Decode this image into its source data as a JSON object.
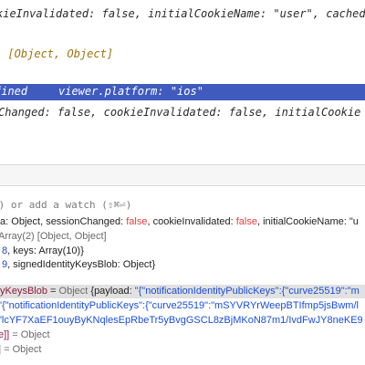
{
  "console": {
    "line1": "kieInvalidated: false, initialCookieName: \"user\", cached",
    "line2": ") [Object, Object]",
    "highlight_a": "fined",
    "highlight_b": "viewer.platform: \"ios\"",
    "line4": "Changed: false, cookieInvalidated: false, initialCookie"
  },
  "watch_hint": "⏎) or add a watch (⇧⌘⏎)",
  "variables": {
    "r1_a": "ta: Object, sessionChanged: ",
    "r1_false1": "false",
    "r1_b": ", cookieInvalidated: ",
    "r1_false2": "false",
    "r1_c": ", initialCookieName: \"u",
    "r2": "Array(2) [Object, Object]",
    "r3_num": "8",
    "r3_rest": ", keys: Array(10)}",
    "r4_num": "9",
    "r4_rest": ", signedIdentityKeysBlob: Object}",
    "r5_name": "yKeysBlob",
    "r5_eq": " = ",
    "r5_type": "Object ",
    "r5_val_a": "{payload: ",
    "r5_val_b": "\"{\"notificationIdentityPublicKeys\":{\"curve25519\":\"m",
    "r6": "'{\"notificationIdentityPublicKeys\":{\"curve25519\":\"mSYVRYrWeepBTIfmp5jsBwm/l",
    "r7": "\"lcYF7XaEF1ouyByKNqlesEpRbeTr5yBvgGSCL8zBjMKoN87m1/IvdFwJY8neKE9",
    "r8_name": "e]]",
    "r8_rest": " = Object",
    "r9_rest": "] = Object"
  },
  "colors": {
    "selection": "#3f5bbd",
    "keyword_false": "#e04040",
    "number": "#1f47c7",
    "string": "#1a4fd1"
  }
}
